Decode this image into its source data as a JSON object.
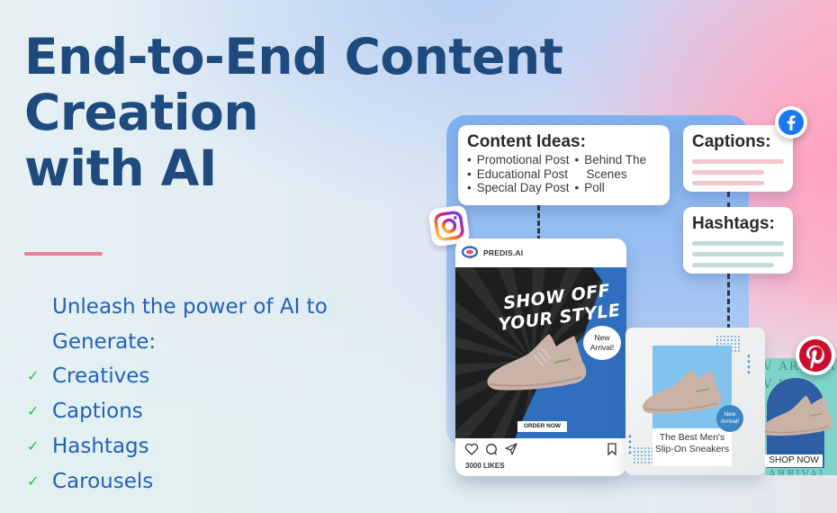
{
  "hero": {
    "title_lines": [
      "End-to-End Content",
      "Creation",
      "with AI"
    ],
    "intro_lines": [
      "Unleash the power of AI to",
      "Generate:"
    ],
    "features": [
      "Creatives",
      "Captions",
      "Hashtags",
      "Carousels"
    ]
  },
  "colors": {
    "title": "#1f4a7e",
    "body_text": "#2361b8",
    "accent_rule": "#ef7f98",
    "check": "#2fb84a"
  },
  "illustration": {
    "content_ideas": {
      "title": "Content Ideas:",
      "col1": [
        "Promotional Post",
        "Educational Post",
        "Special Day Post"
      ],
      "col2_line1": "Behind The",
      "col2_line1_cont": "Scenes",
      "col2_line3": "Poll"
    },
    "captions_card": {
      "title": "Captions:"
    },
    "hashtags_card": {
      "title": "Hashtags:"
    },
    "post": {
      "brand": "PREDIS.AI",
      "headline_1": "SHOW OFF",
      "headline_2": "YOUR STYLE",
      "badge_1": "New",
      "badge_2": "Arrival!",
      "cta": "ORDER NOW",
      "likes": "3000 LIKES"
    },
    "carousel": {
      "caption_1": "The Best Men's",
      "caption_2": "Slip-On Sneakers",
      "badge_1": "New",
      "badge_2": "Arrival!"
    },
    "pin": {
      "cta": "SHOP NOW",
      "watermark_1": "V ARRIVAL",
      "watermark_2": "V VAL",
      "watermark_3": "ARRIVAL"
    },
    "social_icons": [
      "instagram-icon",
      "facebook-icon",
      "pinterest-icon"
    ]
  }
}
